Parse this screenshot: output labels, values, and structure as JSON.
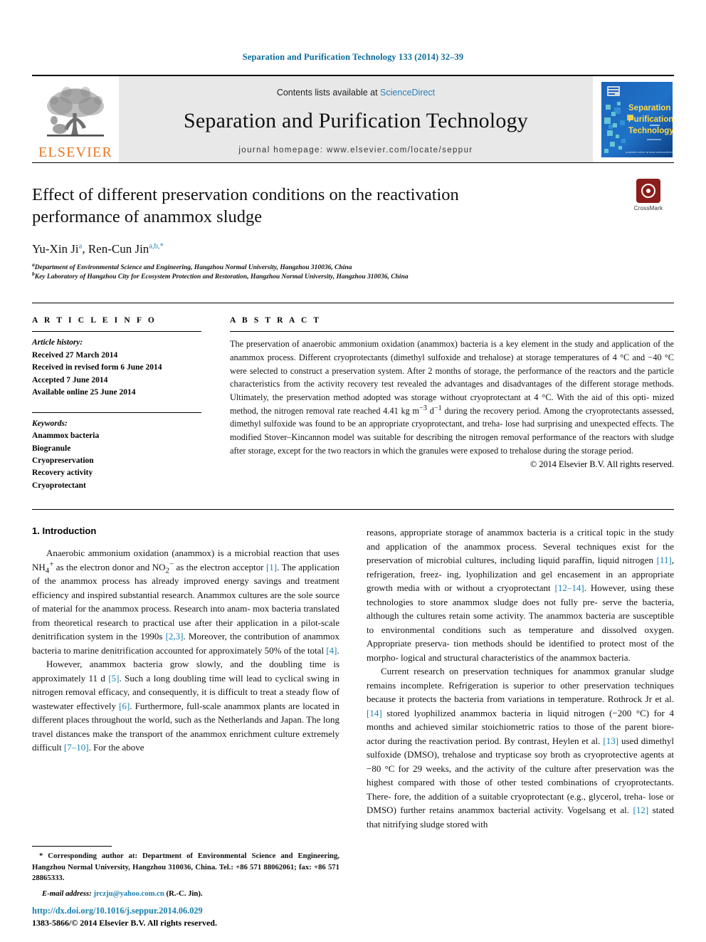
{
  "running_head": "Separation and Purification Technology 133 (2014) 32–39",
  "masthead": {
    "publisher_name": "ELSEVIER",
    "contents_prefix": "Contents lists available at ",
    "contents_link": "ScienceDirect",
    "journal_title": "Separation and Purification Technology",
    "homepage_line": "journal homepage: www.elsevier.com/locate/seppur",
    "cover": {
      "line1": "Separation",
      "line2": "Purification",
      "line3": "Technology",
      "and_mark": "and",
      "bg_color": "#1f6fc4",
      "text_color": "#ffd94a"
    },
    "band_color": "#e8e8e8",
    "elsevier_orange": "#e87722"
  },
  "article": {
    "title": "Effect of different preservation conditions on the reactivation performance of anammox sludge",
    "authors": "Yu-Xin Ji ᵃ, Ren-Cun Jin ᵃ,ᵇ,*",
    "author_parts": [
      {
        "name": "Yu-Xin Ji",
        "marks": "a"
      },
      {
        "name": "Ren-Cun Jin",
        "marks": "a,b,*"
      }
    ],
    "affiliations": [
      {
        "mark": "a",
        "text": "Department of Environmental Science and Engineering, Hangzhou Normal University, Hangzhou 310036, China"
      },
      {
        "mark": "b",
        "text": "Key Laboratory of Hangzhou City for Ecosystem Protection and Restoration, Hangzhou Normal University, Hangzhou 310036, China"
      }
    ],
    "crossmark_label": "CrossMark"
  },
  "info": {
    "heading": "A R T I C L E    I N F O",
    "history_label": "Article history:",
    "history": [
      "Received 27 March 2014",
      "Received in revised form 6 June 2014",
      "Accepted 7 June 2014",
      "Available online 25 June 2014"
    ],
    "keywords_label": "Keywords:",
    "keywords": [
      "Anammox bacteria",
      "Biogranule",
      "Cryopreservation",
      "Recovery activity",
      "Cryoprotectant"
    ]
  },
  "abstract": {
    "heading": "A B S T R A C T",
    "text": "The preservation of anaerobic ammonium oxidation (anammox) bacteria is a key element in the study and application of the anammox process. Different cryoprotectants (dimethyl sulfoxide and trehalose) at storage temperatures of 4 °C and −40 °C were selected to construct a preservation system. After 2 months of storage, the performance of the reactors and the particle characteristics from the activity recovery test revealed the advantages and disadvantages of the different storage methods. Ultimately, the preservation method adopted was storage without cryoprotectant at 4 °C. With the aid of this optimized method, the nitrogen removal rate reached 4.41 kg m−3 d−1 during the recovery period. Among the cryoprotectants assessed, dimethyl sulfoxide was found to be an appropriate cryoprotectant, and trehalose had surprising and unexpected effects. The modified Stover–Kincannon model was suitable for describing the nitrogen removal performance of the reactors with sludge after storage, except for the two reactors in which the granules were exposed to trehalose during the storage period.",
    "copyright": "© 2014 Elsevier B.V. All rights reserved."
  },
  "body": {
    "section_heading": "1. Introduction",
    "left_paragraphs": [
      "Anaerobic ammonium oxidation (anammox) is a microbial reaction that uses NH4+ as the electron donor and NO2− as the electron acceptor [1]. The application of the anammox process has already improved energy savings and treatment efficiency and inspired substantial research. Anammox cultures are the sole source of material for the anammox process. Research into anammox bacteria translated from theoretical research to practical use after their application in a pilot-scale denitrification system in the 1990s [2,3]. Moreover, the contribution of anammox bacteria to marine denitrification accounted for approximately 50% of the total [4].",
      "However, anammox bacteria grow slowly, and the doubling time is approximately 11 d [5]. Such a long doubling time will lead to cyclical swing in nitrogen removal efficacy, and consequently, it is difficult to treat a steady flow of wastewater effectively [6]. Furthermore, full-scale anammox plants are located in different places throughout the world, such as the Netherlands and Japan. The long travel distances make the transport of the anammox enrichment culture extremely difficult [7–10]. For the above"
    ],
    "right_paragraphs": [
      "reasons, appropriate storage of anammox bacteria is a critical topic in the study and application of the anammox process. Several techniques exist for the preservation of microbial cultures, including liquid paraffin, liquid nitrogen [11], refrigeration, freezing, lyophilization and gel encasement in an appropriate growth media with or without a cryoprotectant [12–14]. However, using these technologies to store anammox sludge does not fully preserve the bacteria, although the cultures retain some activity. The anammox bacteria are susceptible to environmental conditions such as temperature and dissolved oxygen. Appropriate preservation methods should be identified to protect most of the morphological and structural characteristics of the anammox bacteria.",
      "Current research on preservation techniques for anammox granular sludge remains incomplete. Refrigeration is superior to other preservation techniques because it protects the bacteria from variations in temperature. Rothrock Jr et al. [14] stored lyophilized anammox bacteria in liquid nitrogen (−200 °C) for 4 months and achieved similar stoichiometric ratios to those of the parent bioreactor during the reactivation period. By contrast, Heylen et al. [13] used dimethyl sulfoxide (DMSO), trehalose and trypticase soy broth as cryoprotective agents at −80 °C for 29 weeks, and the activity of the culture after preservation was the highest compared with those of other tested combinations of cryoprotectants. Therefore, the addition of a suitable cryoprotectant (e.g., glycerol, trehalose or DMSO) further retains anammox bacterial activity. Vogelsang et al. [12] stated that nitrifying sludge stored with"
    ]
  },
  "footnotes": {
    "corresponding": "* Corresponding author at: Department of Environmental Science and Engineering, Hangzhou Normal University, Hangzhou 310036, China. Tel.: +86 571 88062061; fax: +86 571 28865333.",
    "email_label": "E-mail address:",
    "email": "jrczju@yahoo.com.cn",
    "email_owner": "(R.-C. Jin).",
    "doi": "http://dx.doi.org/10.1016/j.seppur.2014.06.029",
    "issn_line": "1383-5866/© 2014 Elsevier B.V. All rights reserved."
  },
  "colors": {
    "link_blue": "#1a7fae",
    "header_blue": "#0b6b9b",
    "elsevier_orange": "#e87722",
    "crossmark_red": "#8c1d1d"
  }
}
